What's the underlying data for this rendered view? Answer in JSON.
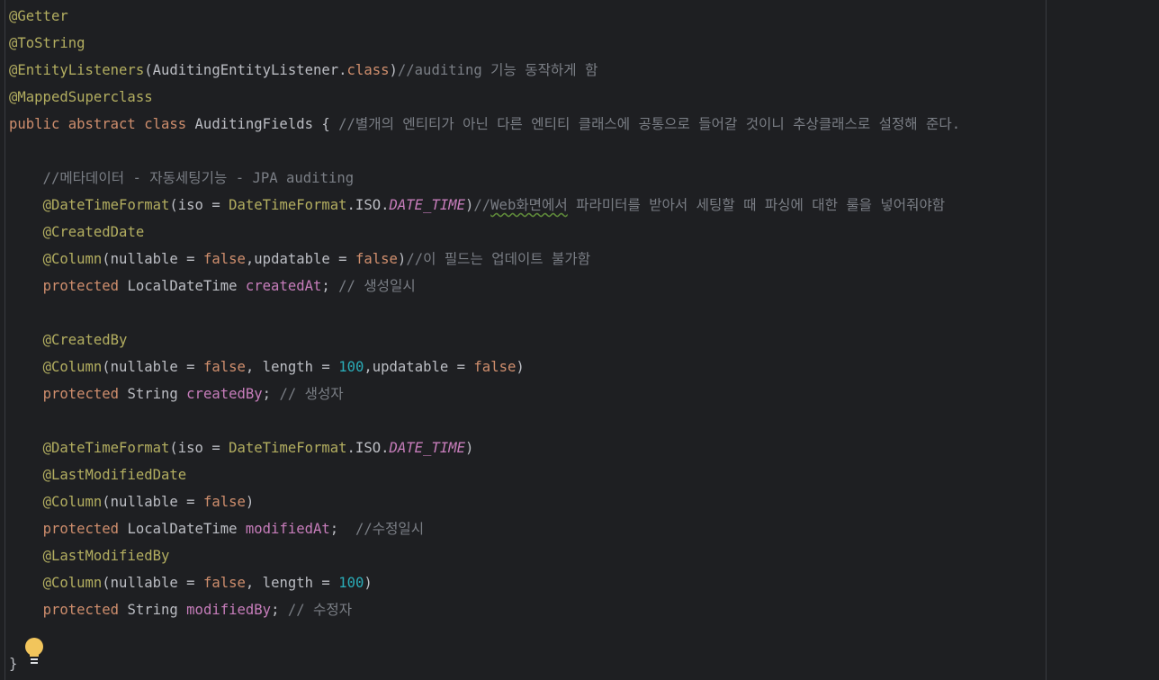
{
  "editor": {
    "lines": [
      [
        {
          "t": "@Getter",
          "c": "ann"
        }
      ],
      [
        {
          "t": "@ToString",
          "c": "ann"
        }
      ],
      [
        {
          "t": "@EntityListeners",
          "c": "ann"
        },
        {
          "t": "(AuditingEntityListener.",
          "c": "cls"
        },
        {
          "t": "class",
          "c": "kw"
        },
        {
          "t": ")",
          "c": "cls"
        },
        {
          "t": "//auditing 기능 동작하게 함",
          "c": "cmt"
        }
      ],
      [
        {
          "t": "@MappedSuperclass",
          "c": "ann"
        }
      ],
      [
        {
          "t": "public abstract class ",
          "c": "kw"
        },
        {
          "t": "AuditingFields { ",
          "c": "cls"
        },
        {
          "t": "//별개의 엔티티가 아닌 다른 엔티티 클래스에 공통으로 들어갈 것이니 추상클래스로 설정해 준다.",
          "c": "cmt"
        }
      ],
      [],
      [
        {
          "t": "    //메타데이터 - 자동세팅기능 - JPA auditing",
          "c": "cmt"
        }
      ],
      [
        {
          "t": "    ",
          "c": "cls"
        },
        {
          "t": "@DateTimeFormat",
          "c": "ann"
        },
        {
          "t": "(iso = ",
          "c": "cls"
        },
        {
          "t": "DateTimeFormat",
          "c": "ann"
        },
        {
          "t": ".ISO.",
          "c": "cls"
        },
        {
          "t": "DATE_TIME",
          "c": "fit"
        },
        {
          "t": ")",
          "c": "cls"
        },
        {
          "t": "//",
          "c": "cmt"
        },
        {
          "t": "Web화면에서",
          "c": "cmt typo"
        },
        {
          "t": " 파라미터를 받아서 세팅할 때 파싱에 대한 룰을 넣어줘야함",
          "c": "cmt"
        }
      ],
      [
        {
          "t": "    ",
          "c": "cls"
        },
        {
          "t": "@CreatedDate",
          "c": "ann"
        }
      ],
      [
        {
          "t": "    ",
          "c": "cls"
        },
        {
          "t": "@Column",
          "c": "ann"
        },
        {
          "t": "(nullable = ",
          "c": "cls"
        },
        {
          "t": "false",
          "c": "kw"
        },
        {
          "t": ",updatable = ",
          "c": "cls"
        },
        {
          "t": "false",
          "c": "kw"
        },
        {
          "t": ")",
          "c": "cls"
        },
        {
          "t": "//이 필드는 업데이트 불가함",
          "c": "cmt"
        }
      ],
      [
        {
          "t": "    ",
          "c": "cls"
        },
        {
          "t": "protected ",
          "c": "kw"
        },
        {
          "t": "LocalDateTime ",
          "c": "cls"
        },
        {
          "t": "createdAt",
          "c": "fld"
        },
        {
          "t": "; ",
          "c": "cls"
        },
        {
          "t": "// 생성일시",
          "c": "cmt"
        }
      ],
      [],
      [
        {
          "t": "    ",
          "c": "cls"
        },
        {
          "t": "@CreatedBy",
          "c": "ann"
        }
      ],
      [
        {
          "t": "    ",
          "c": "cls"
        },
        {
          "t": "@Column",
          "c": "ann"
        },
        {
          "t": "(nullable = ",
          "c": "cls"
        },
        {
          "t": "false",
          "c": "kw"
        },
        {
          "t": ", length = ",
          "c": "cls"
        },
        {
          "t": "100",
          "c": "num"
        },
        {
          "t": ",updatable = ",
          "c": "cls"
        },
        {
          "t": "false",
          "c": "kw"
        },
        {
          "t": ")",
          "c": "cls"
        }
      ],
      [
        {
          "t": "    ",
          "c": "cls"
        },
        {
          "t": "protected ",
          "c": "kw"
        },
        {
          "t": "String ",
          "c": "cls"
        },
        {
          "t": "createdBy",
          "c": "fld"
        },
        {
          "t": "; ",
          "c": "cls"
        },
        {
          "t": "// 생성자",
          "c": "cmt"
        }
      ],
      [],
      [
        {
          "t": "    ",
          "c": "cls"
        },
        {
          "t": "@DateTimeFormat",
          "c": "ann"
        },
        {
          "t": "(iso = ",
          "c": "cls"
        },
        {
          "t": "DateTimeFormat",
          "c": "ann"
        },
        {
          "t": ".ISO.",
          "c": "cls"
        },
        {
          "t": "DATE_TIME",
          "c": "fit"
        },
        {
          "t": ")",
          "c": "cls"
        }
      ],
      [
        {
          "t": "    ",
          "c": "cls"
        },
        {
          "t": "@LastModifiedDate",
          "c": "ann"
        }
      ],
      [
        {
          "t": "    ",
          "c": "cls"
        },
        {
          "t": "@Column",
          "c": "ann"
        },
        {
          "t": "(nullable = ",
          "c": "cls"
        },
        {
          "t": "false",
          "c": "kw"
        },
        {
          "t": ")",
          "c": "cls"
        }
      ],
      [
        {
          "t": "    ",
          "c": "cls"
        },
        {
          "t": "protected ",
          "c": "kw"
        },
        {
          "t": "LocalDateTime ",
          "c": "cls"
        },
        {
          "t": "modifiedAt",
          "c": "fld"
        },
        {
          "t": ";  ",
          "c": "cls"
        },
        {
          "t": "//수정일시",
          "c": "cmt"
        }
      ],
      [
        {
          "t": "    ",
          "c": "cls"
        },
        {
          "t": "@LastModifiedBy",
          "c": "ann"
        }
      ],
      [
        {
          "t": "    ",
          "c": "cls"
        },
        {
          "t": "@Column",
          "c": "ann"
        },
        {
          "t": "(nullable = ",
          "c": "cls"
        },
        {
          "t": "false",
          "c": "kw"
        },
        {
          "t": ", length = ",
          "c": "cls"
        },
        {
          "t": "100",
          "c": "num"
        },
        {
          "t": ")",
          "c": "cls"
        }
      ],
      [
        {
          "t": "    ",
          "c": "cls"
        },
        {
          "t": "protected ",
          "c": "kw"
        },
        {
          "t": "String ",
          "c": "cls"
        },
        {
          "t": "modifiedBy",
          "c": "fld"
        },
        {
          "t": "; ",
          "c": "cls"
        },
        {
          "t": "// 수정자",
          "c": "cmt"
        }
      ],
      [],
      [
        {
          "t": "}",
          "c": "cls"
        }
      ]
    ],
    "intention_icon": "lightbulb-icon"
  },
  "colors": {
    "background": "#1e1f22",
    "annotation": "#b3ae60",
    "keyword": "#cf8e6d",
    "text": "#bcbec4",
    "comment": "#7a7e85",
    "field": "#c77dbb",
    "number": "#2aacb8",
    "bulb": "#f2c55c"
  }
}
